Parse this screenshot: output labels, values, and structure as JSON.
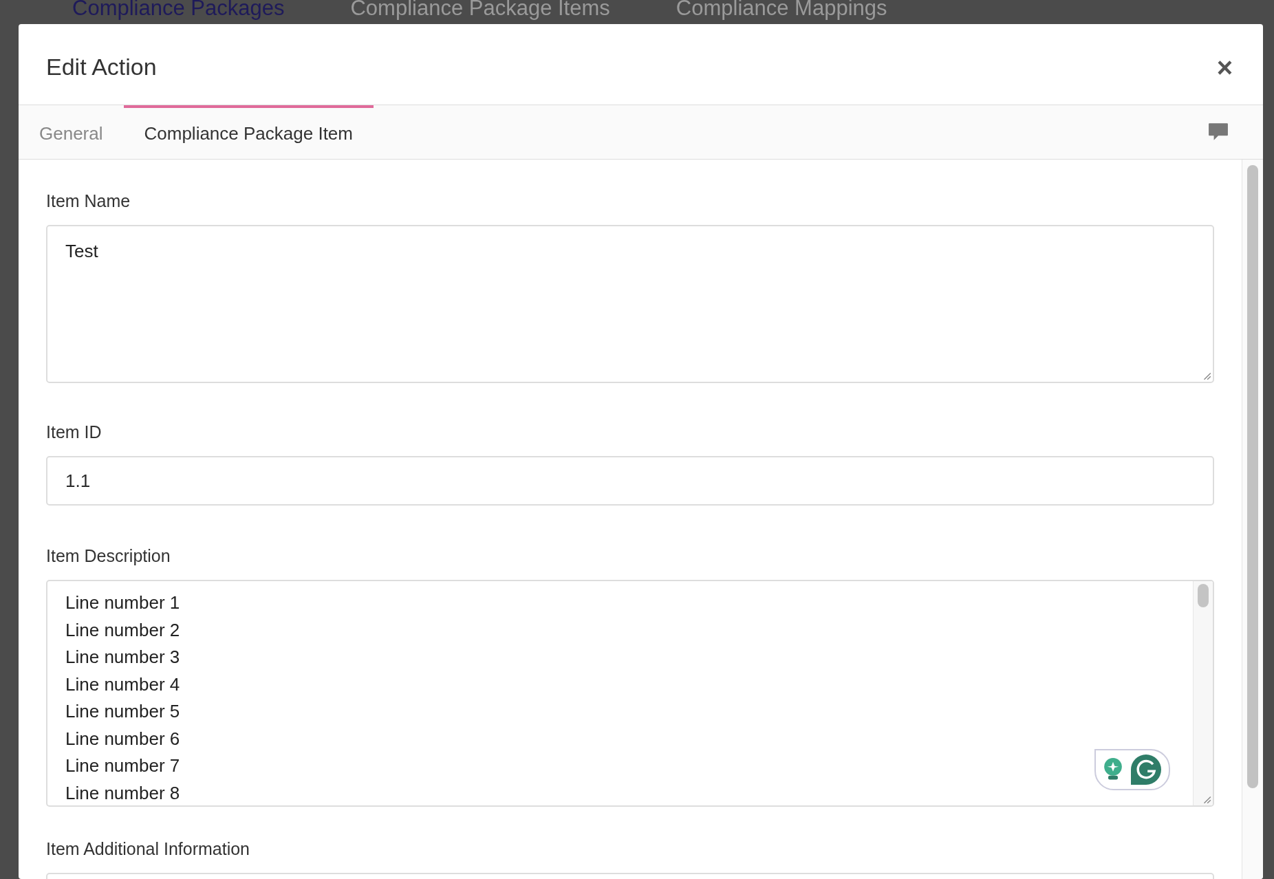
{
  "background_tabs": [
    {
      "label": "Compliance Packages",
      "selected": true
    },
    {
      "label": "Compliance Package Items",
      "selected": false
    },
    {
      "label": "Compliance Mappings",
      "selected": false
    }
  ],
  "dialog": {
    "title": "Edit Action",
    "close": "×",
    "tabs": [
      {
        "label": "General",
        "selected": false
      },
      {
        "label": "Compliance Package Item",
        "selected": true
      }
    ],
    "fields": [
      {
        "kind": "textarea",
        "label": "Item Name",
        "lines": [
          "Test"
        ]
      },
      {
        "kind": "input",
        "label": "Item ID",
        "value": "1.1"
      },
      {
        "kind": "scrolling_textarea",
        "label": "Item Description",
        "lines": [
          "Line number 1",
          "Line number 2",
          "Line number 3",
          "Line number 4",
          "Line number 5",
          "Line number 6",
          "Line number 7",
          "Line number 8"
        ]
      },
      {
        "kind": "input",
        "label": "Item Additional Information"
      }
    ]
  }
}
